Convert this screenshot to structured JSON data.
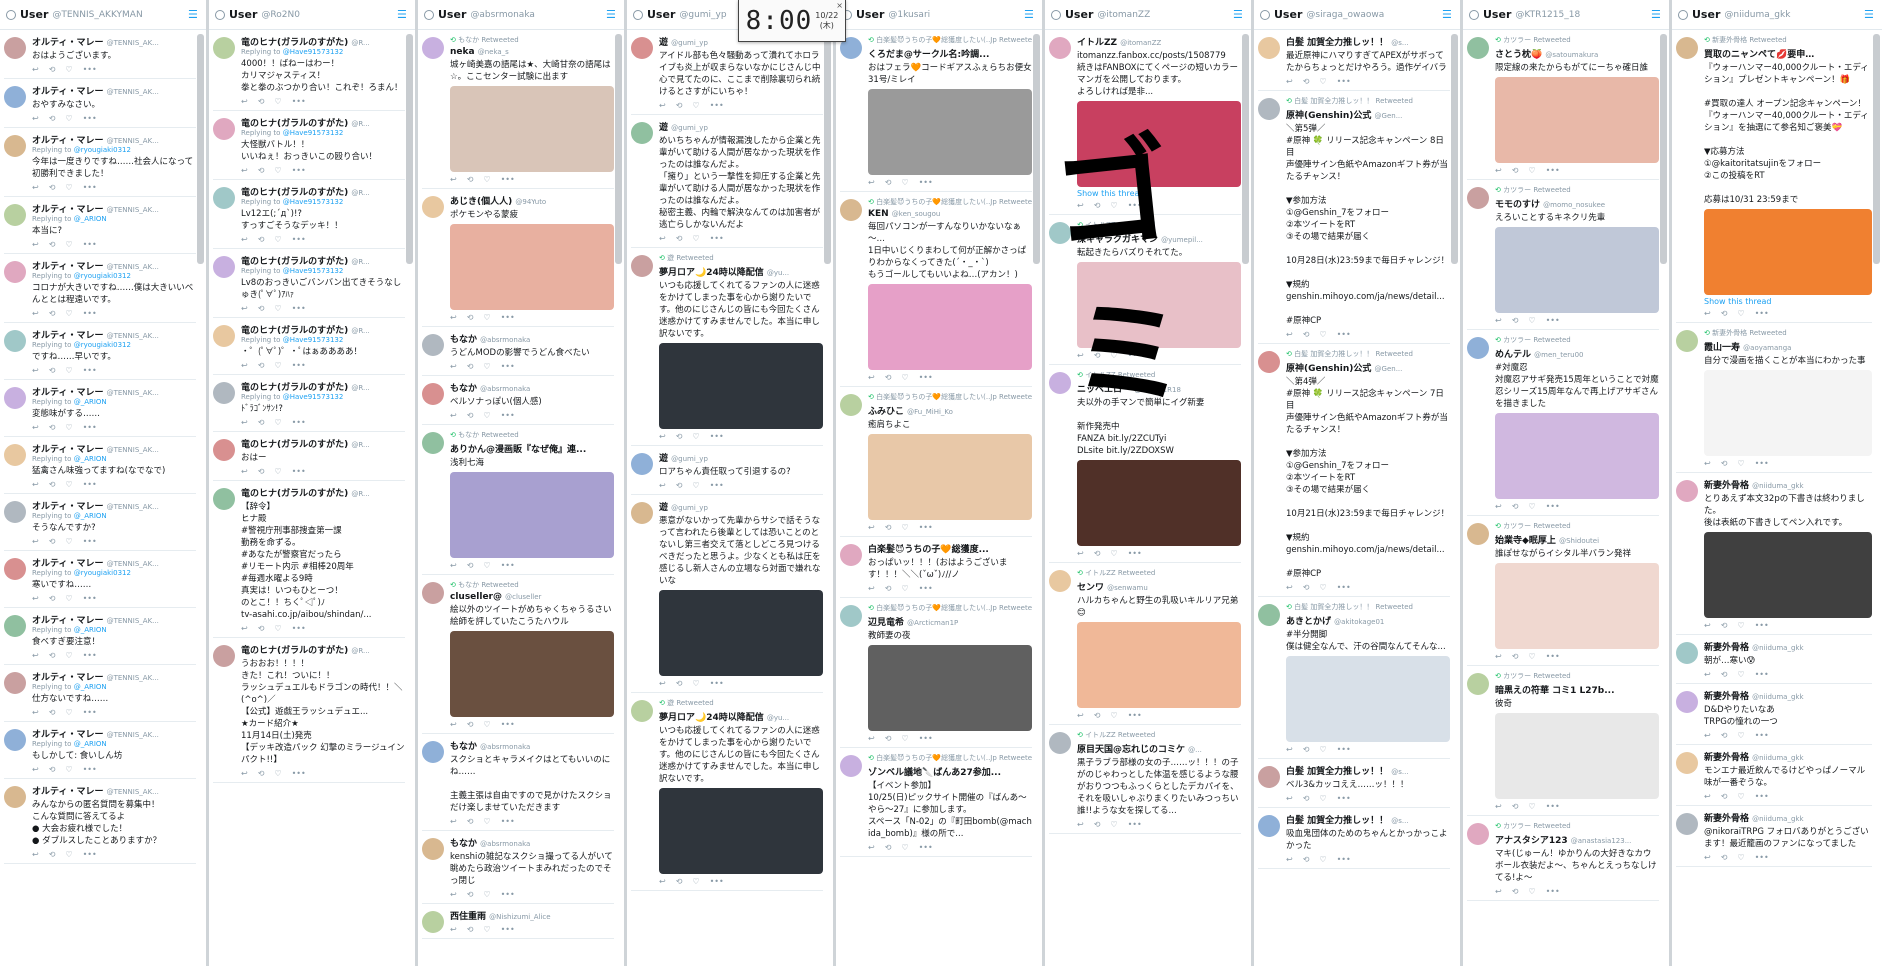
{
  "columns": [
    {
      "title": "User",
      "handle": "@TENNIS_AKKYMAN",
      "tweets": [
        {
          "name": "オルティ・マレー",
          "handle": "@TENNIS_AK...",
          "reply": "",
          "text": "おはようございます。"
        },
        {
          "name": "オルティ・マレー",
          "handle": "@TENNIS_AK...",
          "reply": "",
          "text": "おやすみなさい。"
        },
        {
          "name": "オルティ・マレー",
          "handle": "@TENNIS_AK...",
          "reply": "@ryougiaki0312",
          "text": "今年は一度きりですね……社会人になって初勝利できました！"
        },
        {
          "name": "オルティ・マレー",
          "handle": "@TENNIS_AK...",
          "reply": "@_ARION",
          "text": "本当に?"
        },
        {
          "name": "オルティ・マレー",
          "handle": "@TENNIS_AK...",
          "reply": "@ryougiaki0312",
          "text": "コロナが大きいですね……僕は大きいいべんととは程遠いです。"
        },
        {
          "name": "オルティ・マレー",
          "handle": "@TENNIS_AK...",
          "reply": "@ryougiaki0312",
          "text": "ですね……早いです。"
        },
        {
          "name": "オルティ・マレー",
          "handle": "@TENNIS_AK...",
          "reply": "@_ARION",
          "text": "変態味がする……"
        },
        {
          "name": "オルティ・マレー",
          "handle": "@TENNIS_AK...",
          "reply": "@_ARION",
          "text": "猛禽さん味強ってますね(なでなで)"
        },
        {
          "name": "オルティ・マレー",
          "handle": "@TENNIS_AK...",
          "reply": "@_ARION",
          "text": "そうなんですか?"
        },
        {
          "name": "オルティ・マレー",
          "handle": "@TENNIS_AK...",
          "reply": "@ryougiaki0312",
          "text": "寒いですね……"
        },
        {
          "name": "オルティ・マレー",
          "handle": "@TENNIS_AK...",
          "reply": "@_ARION",
          "text": "食べすぎ要注意！"
        },
        {
          "name": "オルティ・マレー",
          "handle": "@TENNIS_AK...",
          "reply": "@_ARION",
          "text": "仕方ないですね……"
        },
        {
          "name": "オルティ・マレー",
          "handle": "@TENNIS_AK...",
          "reply": "@_ARION",
          "text": "もしかして: 食いしん坊"
        },
        {
          "name": "オルティ・マレー",
          "handle": "@TENNIS_AK...",
          "reply": "",
          "text": "みんなからの匿名質問を募集中！\nこんな質問に答えてるよ\n● 大会お疲れ様でした！\n● ダブルスしたことありますか？"
        }
      ]
    },
    {
      "title": "User",
      "handle": "@Ro2N0",
      "tweets": [
        {
          "name": "竜のヒナ(ガラルのすがた)",
          "handle": "@R...",
          "reply": "@Have91573132",
          "text": "4000！！ばねーはわー！\nカリマジャスティス！\n拳と拳のぶつかり合い！これぞ！ろまん！"
        },
        {
          "name": "竜のヒナ(ガラルのすがた)",
          "handle": "@R...",
          "reply": "@Have91573132",
          "text": "大怪獣バトル！！\nいいねぇ！おっきいこの殴り合い！"
        },
        {
          "name": "竜のヒナ(ガラルのすがた)",
          "handle": "@R...",
          "reply": "@Have91573132",
          "text": "Lv12エ(;´д`)!?\nすっすごそうなデッキ！！"
        },
        {
          "name": "竜のヒナ(ガラルのすがた)",
          "handle": "@R...",
          "reply": "@Have91573132",
          "text": "Lv8のおっきいごバンバン出てきそうなしゅき(ﾟ∀ﾟ)ｱﾊｧ"
        },
        {
          "name": "竜のヒナ(ガラルのすがた)",
          "handle": "@R...",
          "reply": "@Have91573132",
          "text": "・゜(ﾟ∀ﾟ)゜・ﾟはぁああああ！"
        },
        {
          "name": "竜のヒナ(ガラルのすがた)",
          "handle": "@R...",
          "reply": "@Have91573132",
          "text": "ﾄﾞﾗｺﾞﾝｻﾝ!?"
        },
        {
          "name": "竜のヒナ(ガラルのすがた)",
          "handle": "@R...",
          "reply": "",
          "text": "おはー"
        },
        {
          "name": "竜のヒナ(ガラルのすがた)",
          "handle": "@R...",
          "reply": "",
          "text": "【辞令】\nヒナ殿\n#警視庁刑事部捜査第一課\n勤務を命ずる。\n#あなたが警察官だったら\n#リモート内示 #相棒20周年\n#毎週水曜よる9時\n真実は！いつもひとーつ！\nのとこ！！ちくﾟ◁ﾟ)ﾉ\ntv-asahi.co.jp/aibou/shindan/..."
        },
        {
          "name": "竜のヒナ(ガラルのすがた)",
          "handle": "@R...",
          "reply": "",
          "text": "うおおお！！！！\nきた！これ！ついに！！\nラッシュデュエルもドラゴンの時代！！＼(^o^)／\n【公式】遊戯王ラッシュデュエ...\n★カード紹介★\n11月14日(土)発売\n【デッキ改造パック 幻撃のミラージュインパクト!!】"
        }
      ]
    },
    {
      "title": "User",
      "handle": "@absrmonaka",
      "tweets": [
        {
          "rt": "もなか Retweeted",
          "name": "neka",
          "handle": "@neka_s",
          "text": "城ヶ崎美嘉の語尾は★、大崎甘奈の語尾は☆。ここセンター試験に出ます",
          "media": "m-a"
        },
        {
          "name": "あじき(個人人)",
          "handle": "@94Yuto",
          "text": "ポケモンやる蒙疲",
          "media": "m-b"
        },
        {
          "name": "もなか",
          "handle": "@absrmonaka",
          "text": "うどんMODの影響でうどん食べたい"
        },
        {
          "name": "もなか",
          "handle": "@absrmonaka",
          "text": "ベルソナっぽい(個人感)"
        },
        {
          "rt": "もなか Retweeted",
          "name": "ありかん@漫画販『なぜ俺』連...",
          "handle": "",
          "text": "浅利七海",
          "media": "m-c"
        },
        {
          "rt": "もなか Retweeted",
          "name": "cluseller@",
          "handle": "@cluseller",
          "text": "絵以外のツイートがめちゃくちゃうるさい絵師を評していたこうたハウル",
          "media": "m-d"
        },
        {
          "name": "もなか",
          "handle": "@absrmonaka",
          "text": "スクショとキャラメイクはとてもいいのにね……\n\n主義主張は自由ですので見かけたスクショだけ楽しませていただきます"
        },
        {
          "name": "もなか",
          "handle": "@absrmonaka",
          "text": "kenshiの雑記なスクショ撮ってる人がいて眺めたら政治ツイートまみれだったのでそっ閉じ"
        },
        {
          "name": "西住重雨",
          "handle": "@Nishizumi_Alice",
          "text": ""
        }
      ]
    },
    {
      "title": "User",
      "handle": "@gumi_yp",
      "tweets": [
        {
          "name": "遊",
          "handle": "@gumi_yp",
          "text": "アイドル部も色々騒動あって潰れてホロライブも炎上が収まらないなかにじさんじ中心で見てたのに、ここまで削除裏切られ続けるとさすがにいちゃ！"
        },
        {
          "name": "遊",
          "handle": "@gumi_yp",
          "text": "めいちちゃんが情報漏洩したから企業と先輩がいて助ける人間が居なかった現状を作ったのは誰なんだよ。\n「擁り」という一撃性を抑圧する企業と先輩がいて助ける人間が居なかった現状を作ったのは誰なんだよ。\n秘密主義、内輪で解決なんてのは加害者が逃亡らしかないんだよ"
        },
        {
          "rt": "遊 Retweeted",
          "name": "夢月ロア🌙24時以降配信",
          "handle": "@yu...",
          "text": "いつも応援してくれてるファンの人に迷惑をかけてしまった事を心から謝りたいです。他のにじさんじの皆にも今回たくさん迷惑かけてすみませんでした。本当に申し訳ないです。",
          "media": "m-e"
        },
        {
          "name": "遊",
          "handle": "@gumi_yp",
          "text": "ロアちゃん責任取って引退するの?"
        },
        {
          "name": "遊",
          "handle": "@gumi_yp",
          "text": "悪意がないかって先輩からサシで話そうなって言われたら後輩としては恐いことのとないし第三者交えて落としどころ見つけるべきだったと思うよ。少なくとも私は圧を感じるし新人さんの立場なら対面で嫌れないな",
          "media": "m-e"
        },
        {
          "rt": "遊 Retweeted",
          "name": "夢月ロア🌙24時以降配信",
          "handle": "@yu...",
          "text": "いつも応援してくれてるファンの人に迷惑をかけてしまった事を心から謝りたいです。他のにじさんじの皆にも今回たくさん迷惑かけてすみませんでした。本当に申し訳ないです。",
          "media": "m-e"
        }
      ]
    },
    {
      "title": "User",
      "handle": "@1kusari",
      "tweets": [
        {
          "rt": "白楽髪😈うちの子🧡総獲度したい(..Jp Retweeted",
          "name": "くろだま@サークル名:吟調...",
          "handle": "",
          "text": "おはフェラ🧡コードギアスふぇらちお便女31号/ミレイ",
          "media": "m-f"
        },
        {
          "rt": "白楽髪😈うちの子🧡総獲度したい(..Jp Retweeted",
          "name": "KEN",
          "handle": "@ken_sougou",
          "text": "毎回パソコンが一すんなりいかないなぁ～…\n1日中いじくりまわして何が正解かさっぱりわからなくってきた(´・_・`)\nもうゴールしてもいいよね…(アカン！)",
          "media": "m-g"
        },
        {
          "rt": "白楽髪😈うちの子🧡総獲度したい(..Jp Retweeted",
          "name": "ふみひこ",
          "handle": "@Fu_MiHi_Ko",
          "text": "癒肩ちよこ",
          "media": "m-h"
        },
        {
          "name": "白楽髪😈うちの子🧡総獲度...",
          "handle": "",
          "text": "おっぱいッ！！！(おはようございます！！！＼＼(ˇωˇ)ﾉ//ノ"
        },
        {
          "rt": "白楽髪😈うちの子🧡総獲度したい(..Jp Retweeted",
          "name": "辺見竜希",
          "handle": "@Arcticman1P",
          "text": "教師妻の夜",
          "media": "m-i"
        },
        {
          "rt": "白楽髪😈うちの子🧡総獲度したい(..Jp Retweeted",
          "name": "ゾンベル議地🔪ばんあ27参加...",
          "handle": "",
          "text": "【イベント参加】\n10/25(日)ピックサイト開催の『ばんあ～やら～27』に参加します。\nスペース「N-02」の『町田bomb(@machida_bomb)』様の所で..."
        }
      ]
    },
    {
      "title": "User",
      "handle": "@itomanZZ",
      "tweets": [
        {
          "name": "イトルZZ",
          "handle": "@itomanZZ",
          "text": "itomanzz.fanbox.cc/posts/1508779\n続きはFANBOXにてくページの短いカラーマンガを公開しております。\nよろしければ是非...",
          "stt": "Show this thread",
          "media": "m-j"
        },
        {
          "rt": "イトルZZ Retweeted",
          "name": "深キャラクガキマン",
          "handle": "@yumepil...",
          "text": "転起きたらバズりそれてた。",
          "media": "m-k"
        },
        {
          "rt": "イトルZZ Retweeted",
          "name": "ニッペエロー",
          "handle": "@nipple1R18",
          "text": "夫以外の手マンで簡単にイグ新妻\n\n新作発売中\nFANZA bit.ly/2ZCUTyi\nDLsite bit.ly/2ZDOXSW",
          "media": "m-l"
        },
        {
          "rt": "イトルZZ Retweeted",
          "name": "センワ",
          "handle": "@senwamu",
          "text": "ハルカちゃんと野生の乳吸いキルリア兄弟😊",
          "media": "m-m"
        },
        {
          "rt": "イトルZZ Retweeted",
          "name": "原目天国@忘れじのコミケ",
          "handle": "@...",
          "text": "黒子ラブラ部様の女の子……ッ！！！の子がのじゃわっとした体温を感じるような腰がおりつつもふっくらとしたデカパイを、それを吸いしゃぶりまくりたいみつっちい誰!!ような女を探してる..."
        }
      ]
    },
    {
      "title": "User",
      "handle": "@siraga_owaowa",
      "tweets": [
        {
          "name": "白髪 加賀全力推しッ！！",
          "handle": "@s...",
          "text": "最近原神にハマりすぎてAPEXがサボってたからちょっとだけやろう。過作ゲイバラ"
        },
        {
          "rt": "白髪 加賀全力推しッ！！ Retweeted",
          "name": "原神(Genshin)公式",
          "handle": "@Gen...",
          "text": "＼第5弾／\n#原神 🍀 リリース記念キャンペーン 8日目\n声優陣サイン色紙やAmazonギフト券が当たるチャンス！\n\n▼参加方法\n①@Genshin_7をフォロー\n②本ツイートをRT\n③その場で結果が届く\n\n10月28日(水)23:59まで毎日チャレンジ！\n\n▼規約\ngenshin.mihoyo.com/ja/news/detail...\n\n#原神CP"
        },
        {
          "rt": "白髪 加賀全力推しッ！！ Retweeted",
          "name": "原神(Genshin)公式",
          "handle": "@Gen...",
          "text": "＼第4弾／\n#原神 🍀 リリース記念キャンペーン 7日目\n声優陣サイン色紙やAmazonギフト券が当たるチャンス！\n\n▼参加方法\n①@Genshin_7をフォロー\n②本ツイートをRT\n③その場で結果が届く\n\n10月21日(水)23:59まで毎日チャレンジ！\n\n▼規約\ngenshin.mihoyo.com/ja/news/detail...\n\n#原神CP"
        },
        {
          "rt": "白髪 加賀全力推しッ！！ Retweeted",
          "name": "あきとかげ",
          "handle": "@akitokage01",
          "text": "#半分開脚\n僕は健全なんで、汗の谷間なんてそんな...",
          "media": "m-n"
        },
        {
          "name": "白髪 加賀全力推しッ！！",
          "handle": "@s...",
          "text": "ベル3&カッコええ……ッ！！！"
        },
        {
          "name": "白髪 加賀全力推しッ！！",
          "handle": "@s...",
          "text": "吸血鬼団体のためのちゃんとかっかっこよかった"
        }
      ]
    },
    {
      "title": "User",
      "handle": "@KTR1215_18",
      "tweets": [
        {
          "rt": "カツラー Retweeted",
          "name": "さとう枕🍑",
          "handle": "@satoumakura",
          "text": "限定線の来たからもがてにーちゃ確日誰",
          "media": "m-o"
        },
        {
          "rt": "カツラー Retweeted",
          "name": "モモのすけ",
          "handle": "@momo_nosukee",
          "text": "えろいことするキネクリ先輩",
          "media": "m-p"
        },
        {
          "rt": "カツラー Retweeted",
          "name": "めんテル",
          "handle": "@men_teru00",
          "text": "#対魔忍\n対魔忍アサギ発売15周年ということで対魔忍シリーズ15周年なんで再上げアサギさんを描きました",
          "media": "m-q"
        },
        {
          "rt": "カツラー Retweeted",
          "name": "始業寺◆眠厚上",
          "handle": "@Shidoutei",
          "text": "誰ぽせながらイシタル半バラン発祥",
          "media": "m-r"
        },
        {
          "rt": "カツラー Retweeted",
          "name": "暗黒えの符華 コミ1 L27b...",
          "handle": "",
          "text": "彼奇",
          "media": "m-s"
        },
        {
          "rt": "カツラー Retweeted",
          "name": "アナスタシア123",
          "handle": "@anastasia123...",
          "text": "マキ(じゅーん！ゆかりんの大好きなカウボール衣装だよ〜、ちゃんとえっちなしけてる!よ〜"
        }
      ]
    },
    {
      "title": "User",
      "handle": "@niiduma_gkk",
      "tweets": [
        {
          "rt": "新妻外骨格 Retweeted",
          "name": "買取のニャンペて💋要申…",
          "handle": "",
          "text": "『ウォーハンマー40,000クルート・エディション』プレゼントキャンペーン！🎁\n\n#買取の達人 オープン記念キャンペーン！\n『ウォーハンマー40,000クルート・エディション』を抽選にて参名知ご褒美💝\n\n▼応募方法\n①@kaitoritatsujinをフォロー\n②この投稿をRT\n\n応募は10/31 23:59まで",
          "media": "m-t",
          "stt": "Show this thread"
        },
        {
          "rt": "新妻外骨格 Retweeted",
          "name": "霞山一寿",
          "handle": "@aoyamanga",
          "text": "自分で漫画を描くことが本当にわかった事",
          "media": "m-u"
        },
        {
          "name": "新妻外骨格",
          "handle": "@niiduma_gkk",
          "text": "とりあえず本文32pの下書きは終わりました。\n後は表紙の下書きしてペン入れです。",
          "media": "m-v"
        },
        {
          "name": "新妻外骨格",
          "handle": "@niiduma_gkk",
          "text": "朝が…寒い😰"
        },
        {
          "name": "新妻外骨格",
          "handle": "@niiduma_gkk",
          "text": "D&Dやりたいなあ\nTRPGの憧れの一つ"
        },
        {
          "name": "新妻外骨格",
          "handle": "@niiduma_gkk",
          "text": "モンエナ最近飲んでるけどやっぱノーマル味が一番ぞうな。"
        },
        {
          "name": "新妻外骨格",
          "handle": "@niiduma_gkk",
          "text": "@nikoraiTRPG フォロバありがとうございます！最近籠画のファンになってました"
        }
      ]
    }
  ],
  "clock": {
    "time": "8:00",
    "date": "10/22",
    "weekday": "(木)",
    "close": "×"
  },
  "overlay_text": "ゴミ",
  "labels": {
    "replying_to": "Replying to"
  }
}
